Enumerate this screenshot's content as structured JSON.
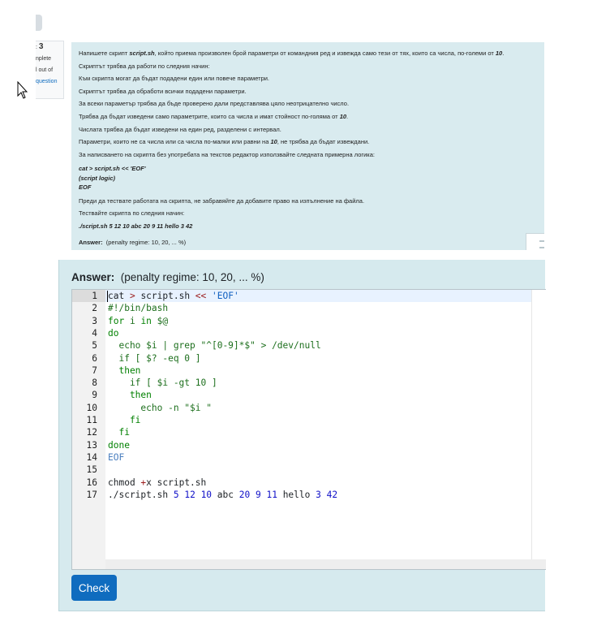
{
  "sidebar": {
    "question_no": "3",
    "line1": "nplete",
    "line2": "l out of",
    "link": "question"
  },
  "question": {
    "intro_a": "Напишете скрипт ",
    "intro_b": "script.sh",
    "intro_c": ", който приема произволен брой параметри от командния ред и извежда само тези от тях, които са числа, по-големи от ",
    "intro_d": "10",
    "intro_e": ".",
    "p1": "Скриптът трябва да работи по следния начин:",
    "p2": "Към скрипта могат да бъдат подадени един или повече параметри.",
    "p3": "Скриптът трябва да обработи всички подадени параметри.",
    "p4": "За всеки параметър трябва да бъде проверено дали представлява цяло неотрицателно число.",
    "p5a": "Трябва да бъдат изведени само параметрите, които са числа и имат стойност по-голяма от ",
    "p5b": "10",
    "p5c": ".",
    "p6": "Числата трябва да бъдат изведени на един ред, разделени с интервал.",
    "p7a": "Параметри, които не са числа или са числа по-малки или равни на ",
    "p7b": "10",
    "p7c": ", не трябва да бъдат извеждани.",
    "p8": "За написването на скрипта без употребата на текстов редактор използвайте следната примерна логика:",
    "code1": "cat > script.sh << 'EOF'",
    "code2": "(script logic)",
    "code3": "EOF",
    "p9": "Преди да тествате работата на скрипта, не забравяйте да добавите право на изпълнение на файла.",
    "p10": "Тествайте скрипта по следния начин:",
    "test_cmd": "./script.sh 5 12 10 abc 20 9 11 hello 3 42",
    "answer_label": "Answer:",
    "answer_note": "(penalty regime: 10, 20, ... %)"
  },
  "answer": {
    "label": "Answer:",
    "penalty": "(penalty regime: 10, 20, ... %)"
  },
  "editor": {
    "lines": [
      {
        "n": "1",
        "tokens": [
          [
            "plain",
            "cat "
          ],
          [
            "op",
            ">"
          ],
          [
            "plain",
            " script.sh "
          ],
          [
            "op",
            "<<"
          ],
          [
            "plain",
            " "
          ],
          [
            "str",
            "'EOF'"
          ]
        ]
      },
      {
        "n": "2",
        "tokens": [
          [
            "cmd",
            "#!/bin/bash"
          ]
        ]
      },
      {
        "n": "3",
        "tokens": [
          [
            "kw",
            "for"
          ],
          [
            "cmd",
            " i "
          ],
          [
            "kw",
            "in"
          ],
          [
            "cmd",
            " $@"
          ]
        ]
      },
      {
        "n": "4",
        "tokens": [
          [
            "kw",
            "do"
          ]
        ]
      },
      {
        "n": "5",
        "tokens": [
          [
            "cmd",
            "  echo $i | grep \"^[0-9]*$\" > /dev/null"
          ]
        ]
      },
      {
        "n": "6",
        "tokens": [
          [
            "cmd",
            "  if [ $? -eq 0 ]"
          ]
        ]
      },
      {
        "n": "7",
        "tokens": [
          [
            "kw",
            "  then"
          ]
        ]
      },
      {
        "n": "8",
        "tokens": [
          [
            "cmd",
            "    if [ $i -gt 10 ]"
          ]
        ]
      },
      {
        "n": "9",
        "tokens": [
          [
            "kw",
            "    then"
          ]
        ]
      },
      {
        "n": "10",
        "tokens": [
          [
            "cmd",
            "      echo -n \"$i \""
          ]
        ]
      },
      {
        "n": "11",
        "tokens": [
          [
            "kw",
            "    fi"
          ]
        ]
      },
      {
        "n": "12",
        "tokens": [
          [
            "kw",
            "  fi"
          ]
        ]
      },
      {
        "n": "13",
        "tokens": [
          [
            "kw",
            "done"
          ]
        ]
      },
      {
        "n": "14",
        "tokens": [
          [
            "eof",
            "EOF"
          ]
        ]
      },
      {
        "n": "15",
        "tokens": []
      },
      {
        "n": "16",
        "tokens": [
          [
            "plain",
            "chmod "
          ],
          [
            "op",
            "+"
          ],
          [
            "plain",
            "x script.sh"
          ]
        ]
      },
      {
        "n": "17",
        "tokens": [
          [
            "plain",
            "./script.sh "
          ],
          [
            "num",
            "5"
          ],
          [
            "plain",
            " "
          ],
          [
            "num",
            "12"
          ],
          [
            "plain",
            " "
          ],
          [
            "num",
            "10"
          ],
          [
            "plain",
            " abc "
          ],
          [
            "num",
            "20"
          ],
          [
            "plain",
            " "
          ],
          [
            "num",
            "9"
          ],
          [
            "plain",
            " "
          ],
          [
            "num",
            "11"
          ],
          [
            "plain",
            " hello "
          ],
          [
            "num",
            "3"
          ],
          [
            "plain",
            " "
          ],
          [
            "num",
            "42"
          ]
        ]
      }
    ]
  },
  "buttons": {
    "check": "Check"
  },
  "colors": {
    "accent": "#0f6cbf",
    "panel": "#d6eaee"
  }
}
